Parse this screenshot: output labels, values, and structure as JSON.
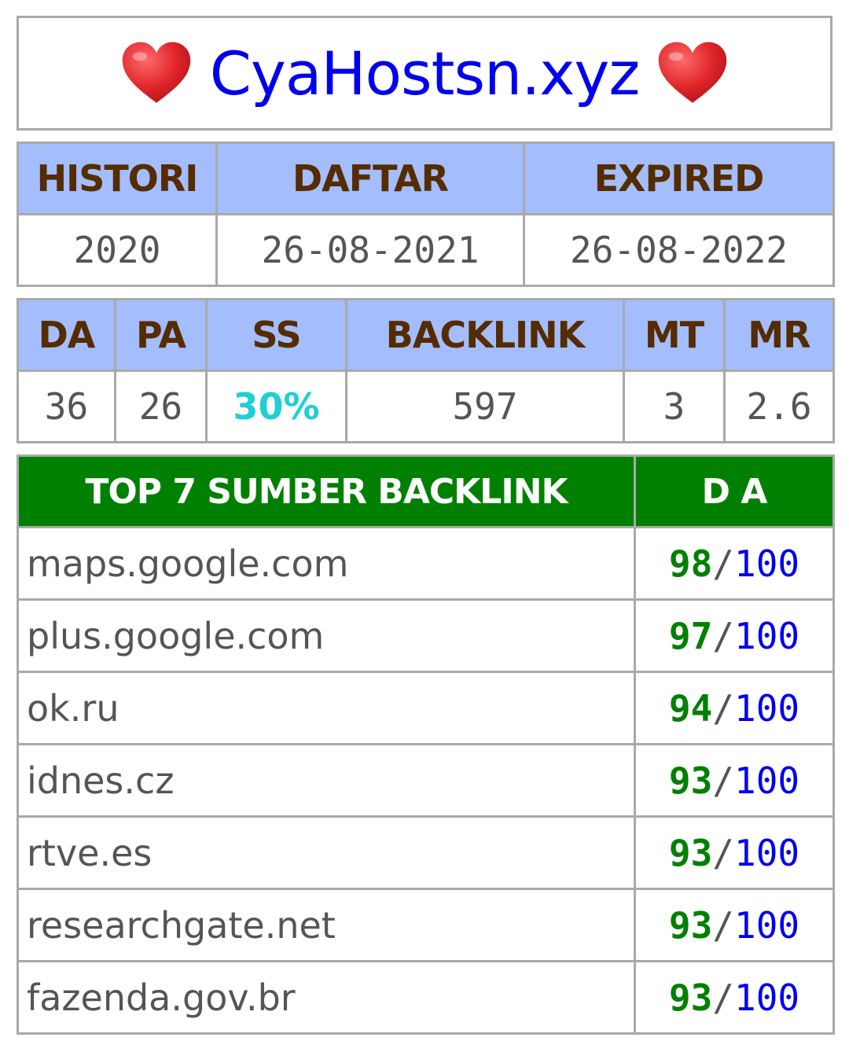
{
  "header": {
    "title": "CyaHostsn.xyz",
    "heart_icon": "red-heart"
  },
  "info": {
    "headers": [
      "HISTORI",
      "DAFTAR",
      "EXPIRED"
    ],
    "values": [
      "2020",
      "26-08-2021",
      "26-08-2022"
    ]
  },
  "metrics": {
    "headers": [
      "DA",
      "PA",
      "SS",
      "BACKLINK",
      "MT",
      "MR"
    ],
    "values": [
      "36",
      "26",
      "30%",
      "597",
      "3",
      "2.6"
    ]
  },
  "backlinks": {
    "header_source": "TOP 7 SUMBER BACKLINK",
    "header_da": "D A",
    "rows": [
      {
        "domain": "maps.google.com",
        "da": "98",
        "sep": "/",
        "max": "100"
      },
      {
        "domain": "plus.google.com",
        "da": "97",
        "sep": "/",
        "max": "100"
      },
      {
        "domain": "ok.ru",
        "da": "94",
        "sep": "/",
        "max": "100"
      },
      {
        "domain": "idnes.cz",
        "da": "93",
        "sep": "/",
        "max": "100"
      },
      {
        "domain": "rtve.es",
        "da": "93",
        "sep": "/",
        "max": "100"
      },
      {
        "domain": "researchgate.net",
        "da": "93",
        "sep": "/",
        "max": "100"
      },
      {
        "domain": "fazenda.gov.br",
        "da": "93",
        "sep": "/",
        "max": "100"
      }
    ]
  },
  "colors": {
    "title": "#0000ee",
    "header_bg": "#a4bdfc",
    "header_text": "#542c00",
    "backlink_header_bg": "#008000",
    "ss_value": "#1ecfd6",
    "da_value": "#008000",
    "da_max": "#0000ee"
  }
}
